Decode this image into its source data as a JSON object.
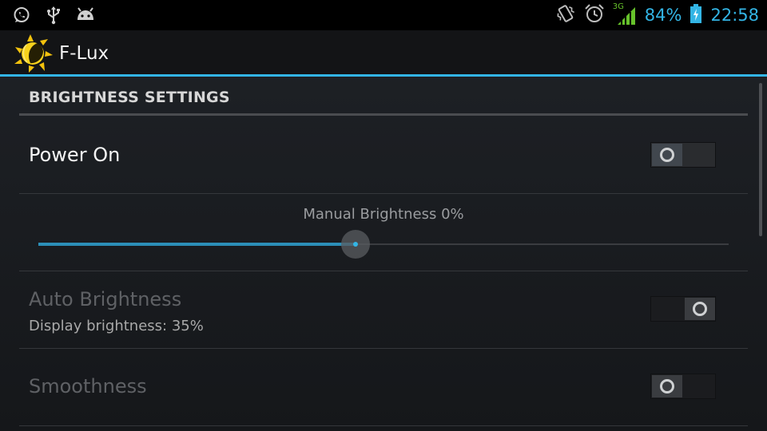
{
  "status_bar": {
    "left_icons": [
      "whatsapp-icon",
      "usb-icon",
      "android-debug-icon"
    ],
    "right_icons": [
      "vibrate-icon",
      "alarm-icon",
      "signal-3g-icon",
      "battery-charging-icon"
    ],
    "network_type": "3G",
    "battery_text": "84%",
    "battery_level": 0.84,
    "clock": "22:58",
    "accent_color": "#33b5e5"
  },
  "action_bar": {
    "app_icon": "sun-app-icon",
    "title": "F-Lux"
  },
  "settings": {
    "section_title": "BRIGHTNESS SETTINGS",
    "power": {
      "title": "Power On",
      "checked": false
    },
    "manual_brightness": {
      "label": "Manual Brightness 0%",
      "slider_level": 0.46
    },
    "auto_brightness": {
      "title": "Auto Brightness",
      "summary": "Display brightness: 35%",
      "checked": true,
      "enabled": false
    },
    "smoothness": {
      "title": "Smoothness",
      "checked": false,
      "enabled": false
    }
  }
}
